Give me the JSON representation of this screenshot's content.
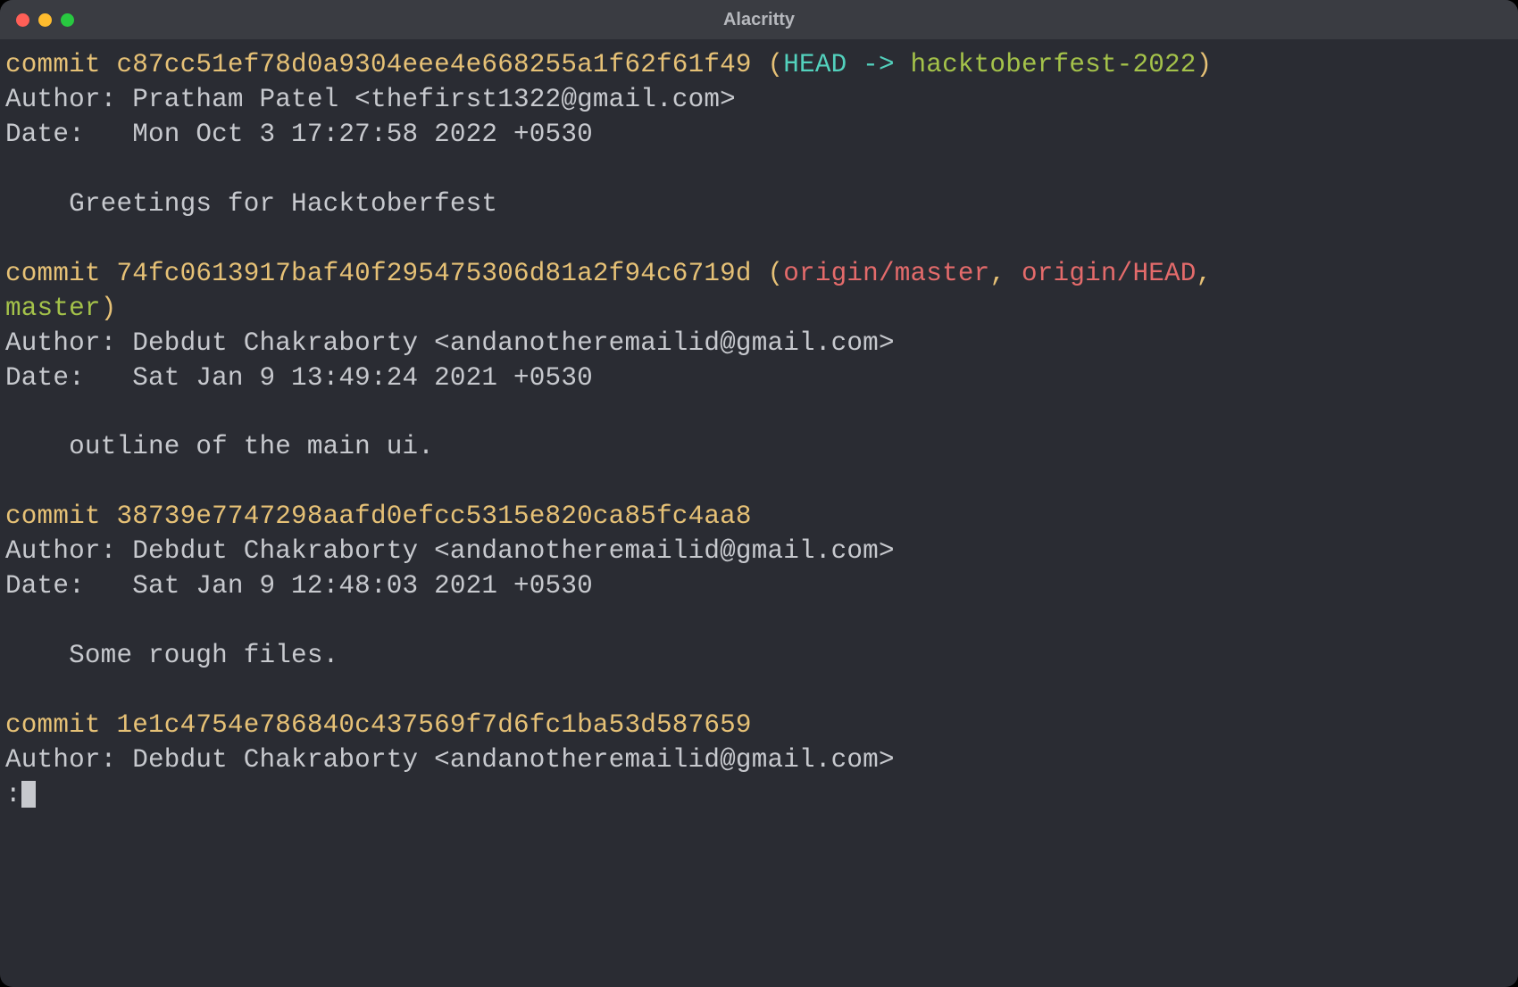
{
  "window": {
    "title": "Alacritty"
  },
  "colors": {
    "bg": "#2a2c33",
    "titlebar": "#3a3c42",
    "text": "#c7c9ce",
    "yellow": "#e6c176",
    "cyan": "#53d1bd",
    "green": "#a4c24a",
    "red": "#e46b6b"
  },
  "commits": [
    {
      "commit_label": "commit ",
      "hash": "c87cc51ef78d0a9304eee4e668255a1f62f61f49",
      "refs_open": " (",
      "head": "HEAD -> ",
      "branch": "hacktoberfest-2022",
      "refs_close": ")",
      "author_line": "Author: Pratham Patel <thefirst1322@gmail.com>",
      "date_line": "Date:   Mon Oct 3 17:27:58 2022 +0530",
      "message": "    Greetings for Hacktoberfest"
    },
    {
      "commit_label": "commit ",
      "hash": "74fc0613917baf40f295475306d81a2f94c6719d",
      "refs_open": " (",
      "remote1": "origin/master",
      "remote_sep1": ", ",
      "remote2": "origin/HEAD",
      "remote_sep2": ", ",
      "local_branch": "master",
      "refs_close": ")",
      "author_line": "Author: Debdut Chakraborty <andanotheremailid@gmail.com>",
      "date_line": "Date:   Sat Jan 9 13:49:24 2021 +0530",
      "message": "    outline of the main ui."
    },
    {
      "commit_label": "commit ",
      "hash": "38739e7747298aafd0efcc5315e820ca85fc4aa8",
      "author_line": "Author: Debdut Chakraborty <andanotheremailid@gmail.com>",
      "date_line": "Date:   Sat Jan 9 12:48:03 2021 +0530",
      "message": "    Some rough files."
    },
    {
      "commit_label": "commit ",
      "hash": "1e1c4754e786840c437569f7d6fc1ba53d587659",
      "author_line": "Author: Debdut Chakraborty <andanotheremailid@gmail.com>"
    }
  ],
  "pager_prompt": ":"
}
